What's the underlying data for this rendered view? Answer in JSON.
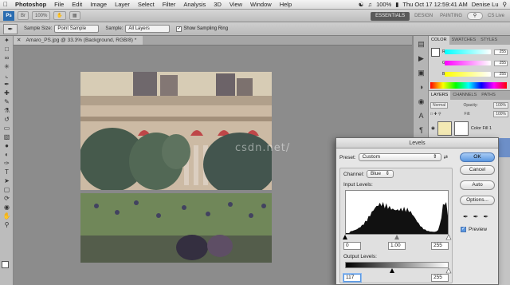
{
  "menubar": {
    "apple": "",
    "app": "Photoshop",
    "items": [
      "File",
      "Edit",
      "Image",
      "Layer",
      "Select",
      "Filter",
      "Analysis",
      "3D",
      "View",
      "Window",
      "Help"
    ],
    "battery": "100%",
    "clock": "Thu Oct 17  12:59:41 AM",
    "user": "Denise Lu"
  },
  "appbar": {
    "logo": "Ps",
    "zoom": "100%",
    "workspaces": {
      "active": "ESSENTIALS",
      "design": "DESIGN",
      "painting": "PAINTING"
    },
    "search_label": "CS Live"
  },
  "options": {
    "sample_size_label": "Sample Size:",
    "sample_size_value": "Point Sample",
    "sample_label": "Sample:",
    "sample_value": "All Layers",
    "ring_label": "Show Sampling Ring"
  },
  "document": {
    "tab_title": "Amaro_PS.jpg @ 33.3% (Background, RGB/8) *"
  },
  "right_panel": {
    "color_tabs": [
      "COLOR",
      "SWATCHES",
      "STYLES"
    ],
    "sliders": [
      {
        "label": "R",
        "value": "255",
        "color": "#00ffff"
      },
      {
        "label": "G",
        "value": "255",
        "color": "#ff00ff"
      },
      {
        "label": "B",
        "value": "255",
        "color": "#ffff00"
      }
    ],
    "layer_tabs": [
      "LAYERS",
      "CHANNELS",
      "PATHS"
    ],
    "blend_mode": "Normal",
    "opacity_label": "Opacity:",
    "opacity_value": "100%",
    "fill_label": "Fill:",
    "fill_value": "100%",
    "layers": [
      {
        "name": "Color Fill 1"
      },
      {
        "name": ""
      }
    ]
  },
  "watermark": "csdn.net/",
  "levels_dialog": {
    "title": "Levels",
    "preset_label": "Preset:",
    "preset_value": "Custom",
    "channel_label": "Channel:",
    "channel_value": "Blue",
    "input_levels_label": "Input Levels:",
    "input_black": "0",
    "input_gamma": "1.00",
    "input_white": "255",
    "output_levels_label": "Output Levels:",
    "output_black": "117",
    "output_white": "255",
    "buttons": {
      "ok": "OK",
      "cancel": "Cancel",
      "auto": "Auto",
      "options": "Options..."
    },
    "preview_label": "Preview",
    "preview_checked": true
  }
}
